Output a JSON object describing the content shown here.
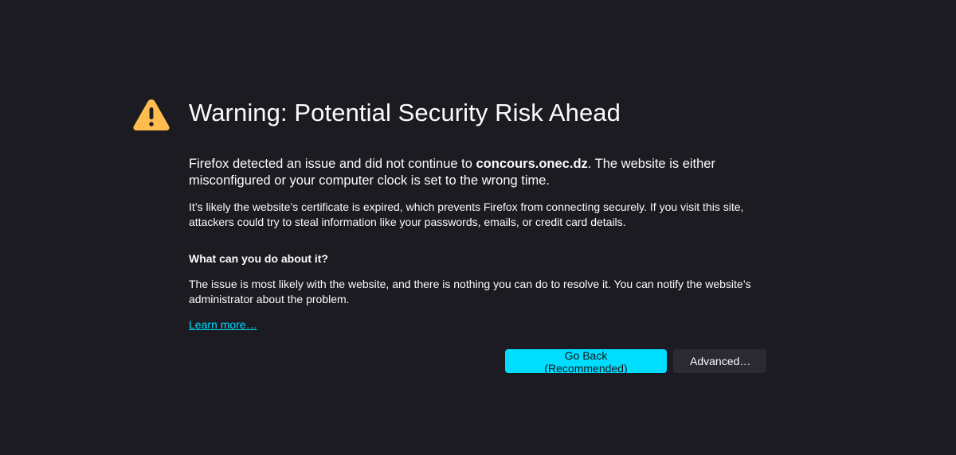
{
  "page": {
    "title": "Warning: Potential Security Risk Ahead",
    "intro_prefix": "Firefox detected an issue and did not continue to ",
    "intro_host": "concours.onec.dz",
    "intro_suffix": ". The website is either misconfigured or your computer clock is set to the wrong time.",
    "detail": "It’s likely the website’s certificate is expired, which prevents Firefox from connecting securely. If you visit this site, attackers could try to steal information like your passwords, emails, or credit card details.",
    "subheading": "What can you do about it?",
    "advice": "The issue is most likely with the website, and there is nothing you can do to resolve it. You can notify the website’s administrator about the problem.",
    "learn_more": "Learn more…"
  },
  "buttons": {
    "go_back": "Go Back (Recommended)",
    "advanced": "Advanced…"
  },
  "icons": {
    "warning": "warning-triangle-icon"
  },
  "colors": {
    "background": "#1c1b22",
    "accent": "#00ddff",
    "warning": "#ffbd4f",
    "secondary_button": "#2b2a33"
  }
}
